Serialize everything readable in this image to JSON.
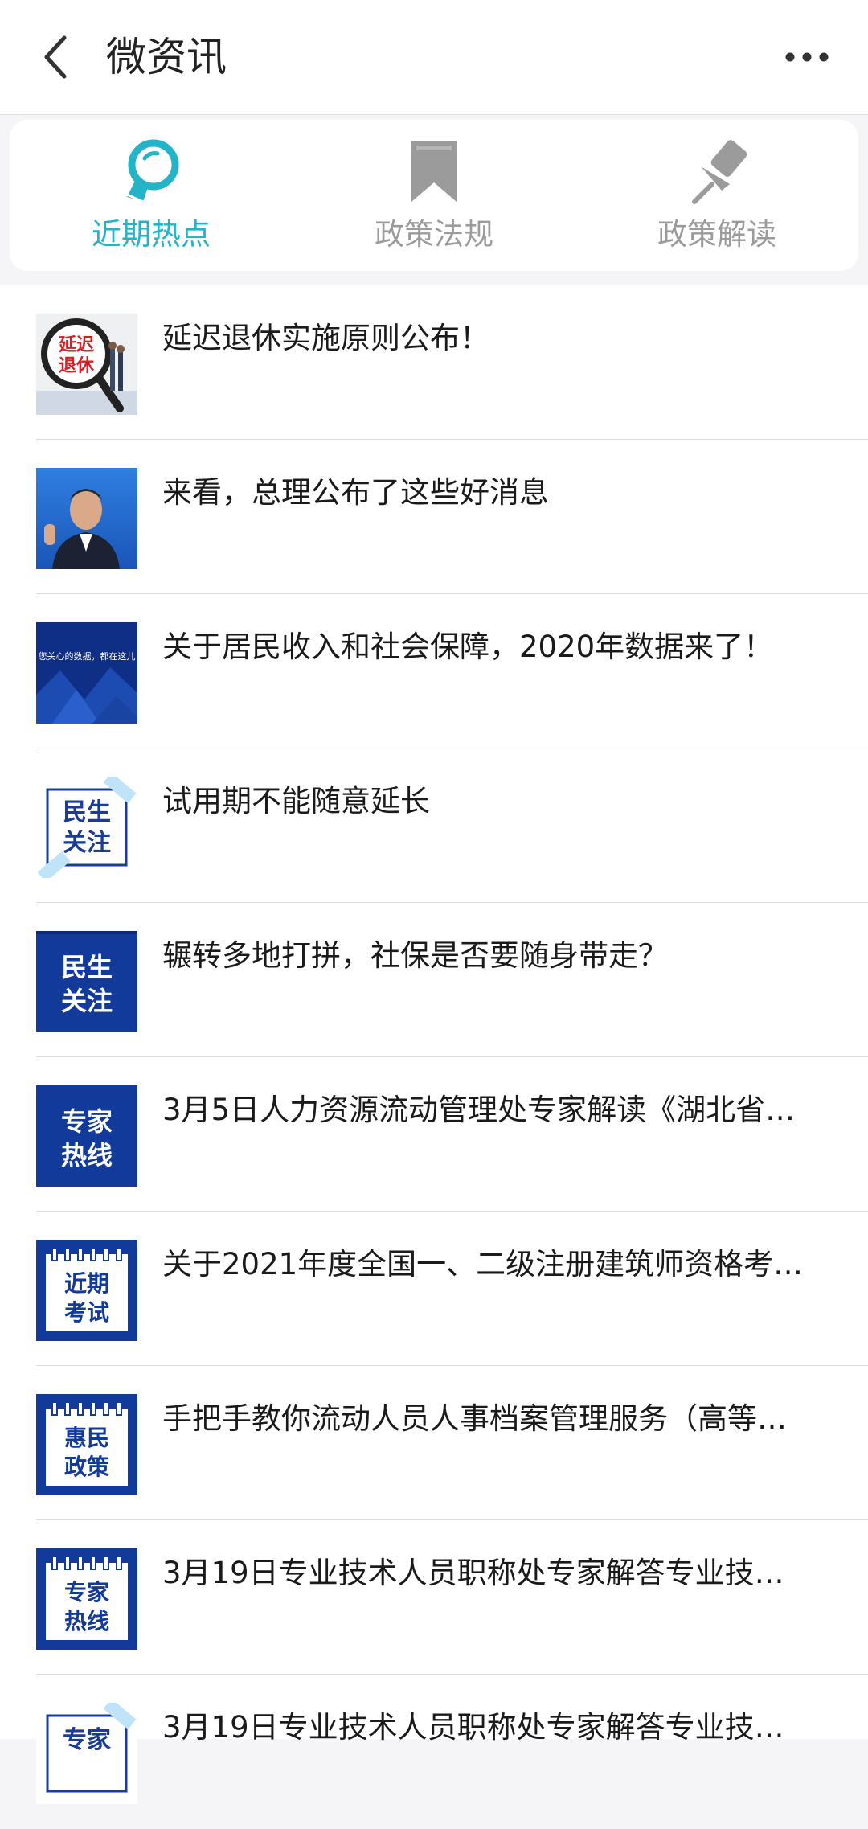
{
  "header": {
    "title": "微资讯",
    "back_icon": "chevron-left-icon",
    "more_icon": "more-horizontal-icon"
  },
  "tabs": [
    {
      "label": "近期热点",
      "icon": "lightbulb-icon",
      "active": true
    },
    {
      "label": "政策法规",
      "icon": "bookmark-icon",
      "active": false
    },
    {
      "label": "政策解读",
      "icon": "pushpin-icon",
      "active": false
    }
  ],
  "colors": {
    "accent": "#23b4c8",
    "inactive": "#9b9b9b",
    "thumb_blue": "#123a9a"
  },
  "articles": [
    {
      "title": "延迟退休实施原则公布！",
      "thumb_text": [
        "延迟",
        "退休"
      ]
    },
    {
      "title": "来看，总理公布了这些好消息"
    },
    {
      "title": "关于居民收入和社会保障，2020年数据来了！",
      "thumb_text": [
        "您关心的数据，都在这儿"
      ]
    },
    {
      "title": "试用期不能随意延长",
      "thumb_text": [
        "民生",
        "关注"
      ]
    },
    {
      "title": "辗转多地打拼，社保是否要随身带走？",
      "thumb_text": [
        "民生",
        "关注"
      ]
    },
    {
      "title": "3月5日人力资源流动管理处专家解读《湖北省…",
      "thumb_text": [
        "专家",
        "热线"
      ]
    },
    {
      "title": "关于2021年度全国一、二级注册建筑师资格考…",
      "thumb_text": [
        "近期",
        "考试"
      ]
    },
    {
      "title": "手把手教你流动人员人事档案管理服务（高等…",
      "thumb_text": [
        "惠民",
        "政策"
      ]
    },
    {
      "title": "3月19日专业技术人员职称处专家解答专业技…",
      "thumb_text": [
        "专家",
        "热线"
      ]
    },
    {
      "title": "3月19日专业技术人员职称处专家解答专业技…",
      "thumb_text": [
        "专家"
      ]
    }
  ]
}
